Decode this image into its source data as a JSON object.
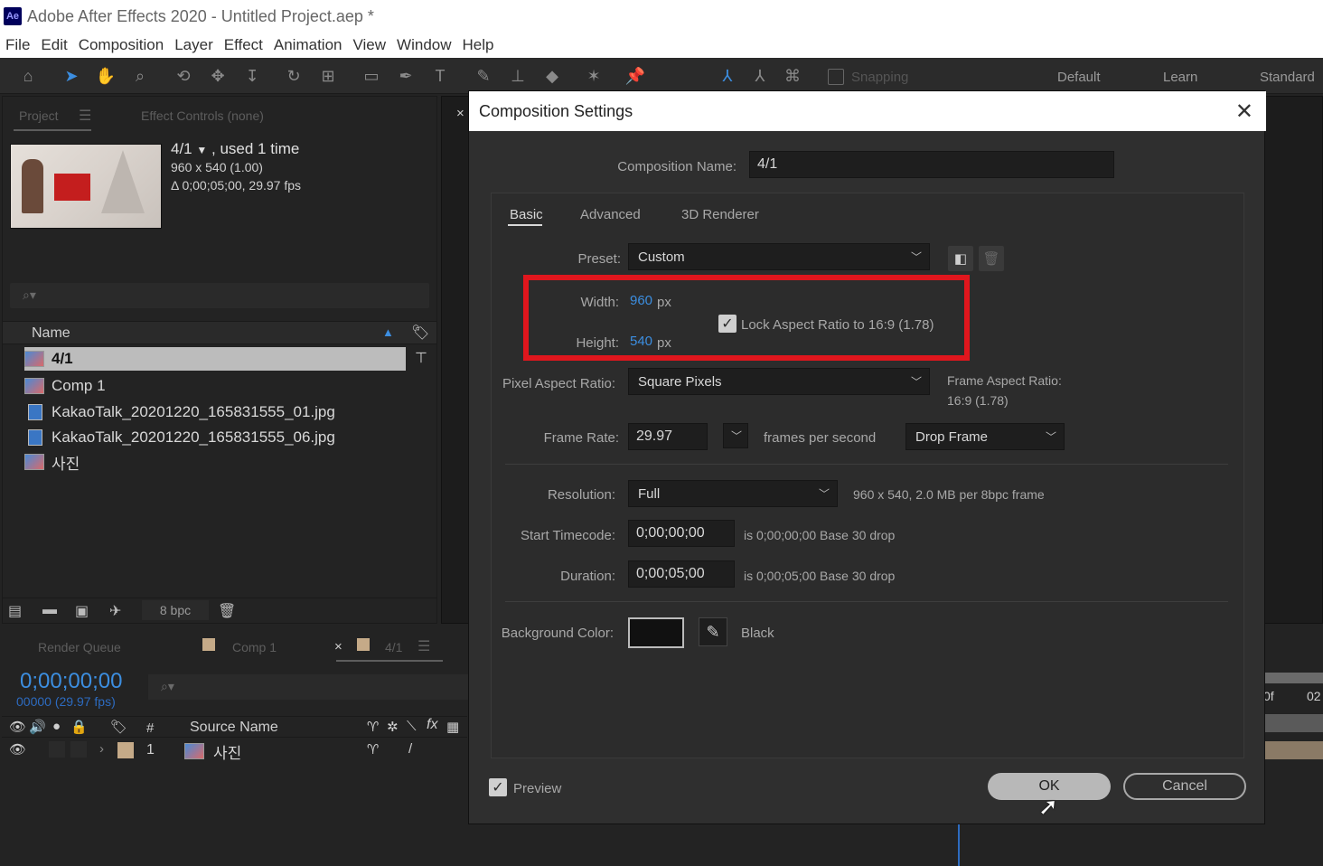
{
  "window": {
    "app_icon": "Ae",
    "title": "Adobe After Effects 2020 - Untitled Project.aep *"
  },
  "menu": [
    "File",
    "Edit",
    "Composition",
    "Layer",
    "Effect",
    "Animation",
    "View",
    "Window",
    "Help"
  ],
  "toolbar": {
    "snapping_label": "Snapping",
    "workspaces": [
      "Default",
      "Learn",
      "Standard"
    ],
    "tools": [
      "home-icon",
      "selection-icon",
      "hand-icon",
      "zoom-icon",
      "orbit-icon",
      "pan-icon",
      "dolly-icon",
      "rotate-icon",
      "pan-behind-icon",
      "rectangle-icon",
      "pen-icon",
      "type-icon",
      "brush-icon",
      "clone-stamp-icon",
      "eraser-icon",
      "roto-brush-icon",
      "puppet-pin-icon"
    ]
  },
  "project_panel": {
    "tab_project": "Project",
    "tab_effect_controls": "Effect Controls  (none)",
    "preview": {
      "name": "4/1",
      "used": ", used 1 time",
      "dimensions": "960 x 540 (1.00)",
      "duration": "Δ 0;00;05;00, 29.97 fps"
    },
    "search_placeholder": "⌕▾",
    "column_name": "Name",
    "items": [
      {
        "name": "4/1",
        "type": "comp",
        "selected": true
      },
      {
        "name": "Comp 1",
        "type": "comp"
      },
      {
        "name": "KakaoTalk_20201220_165831555_01.jpg",
        "type": "image"
      },
      {
        "name": "KakaoTalk_20201220_165831555_06.jpg",
        "type": "image"
      },
      {
        "name": "사진",
        "type": "comp"
      }
    ],
    "bpc": "8 bpc"
  },
  "timeline": {
    "tab_render_queue": "Render Queue",
    "tab_comp1": "Comp 1",
    "tab_active": "4/1",
    "timecode": "0;00;00;00",
    "frames": "00000 (29.97 fps)",
    "col_hash": "#",
    "col_source": "Source Name",
    "layer_num": "1",
    "layer_name": "사진",
    "ruler_a": "0f",
    "ruler_b": "02"
  },
  "dialog": {
    "title": "Composition Settings",
    "comp_name_label": "Composition Name:",
    "comp_name_value": "4/1",
    "tabs": [
      "Basic",
      "Advanced",
      "3D Renderer"
    ],
    "preset_label": "Preset:",
    "preset_value": "Custom",
    "width_label": "Width:",
    "width_value": "960",
    "height_label": "Height:",
    "height_value": "540",
    "px": "px",
    "lock_aspect": "Lock Aspect Ratio to 16:9 (1.78)",
    "par_label": "Pixel Aspect Ratio:",
    "par_value": "Square Pixels",
    "far_label": "Frame Aspect Ratio:",
    "far_value": "16:9 (1.78)",
    "fps_label": "Frame Rate:",
    "fps_value": "29.97",
    "fps_unit": "frames per second",
    "drop_frame": "Drop Frame",
    "resolution_label": "Resolution:",
    "resolution_value": "Full",
    "resolution_info": "960 x 540, 2.0 MB per 8bpc frame",
    "start_tc_label": "Start Timecode:",
    "start_tc_value": "0;00;00;00",
    "start_tc_info": "is 0;00;00;00  Base 30  drop",
    "duration_label": "Duration:",
    "duration_value": "0;00;05;00",
    "duration_info": "is 0;00;05;00  Base 30  drop",
    "bg_label": "Background Color:",
    "bg_name": "Black",
    "preview_label": "Preview",
    "ok": "OK",
    "cancel": "Cancel"
  },
  "colors": {
    "highlight": "#e0161d",
    "accent_blue": "#3c8ee0",
    "bg": "#232323"
  }
}
